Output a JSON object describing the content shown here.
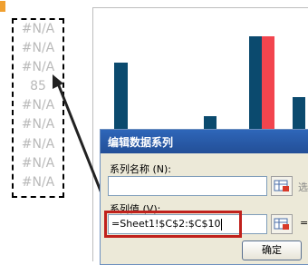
{
  "cells": [
    "#N/A",
    "#N/A",
    "#N/A",
    "85",
    "#N/A",
    "#N/A",
    "#N/A",
    "#N/A",
    "#N/A"
  ],
  "chart": {
    "series_colors": [
      "#0b4a6e",
      "#f2454e"
    ]
  },
  "dialog": {
    "title": "编辑数据系列",
    "series_name_label": "系列名称 (N):",
    "series_name_value": "",
    "series_name_trailing": "选",
    "series_values_label": "系列值 (V):",
    "series_values_value": "=Sheet1!$C$2:$C$10",
    "series_values_trailing": "=",
    "ok_label": "确定"
  },
  "colors": {
    "highlight_box": "#c0211c",
    "titlebar": "#2e66b9",
    "cell_text": "#b9b9b9"
  },
  "icons": {
    "range_picker": "range-select-icon",
    "arrow": "pointer-arrow"
  }
}
